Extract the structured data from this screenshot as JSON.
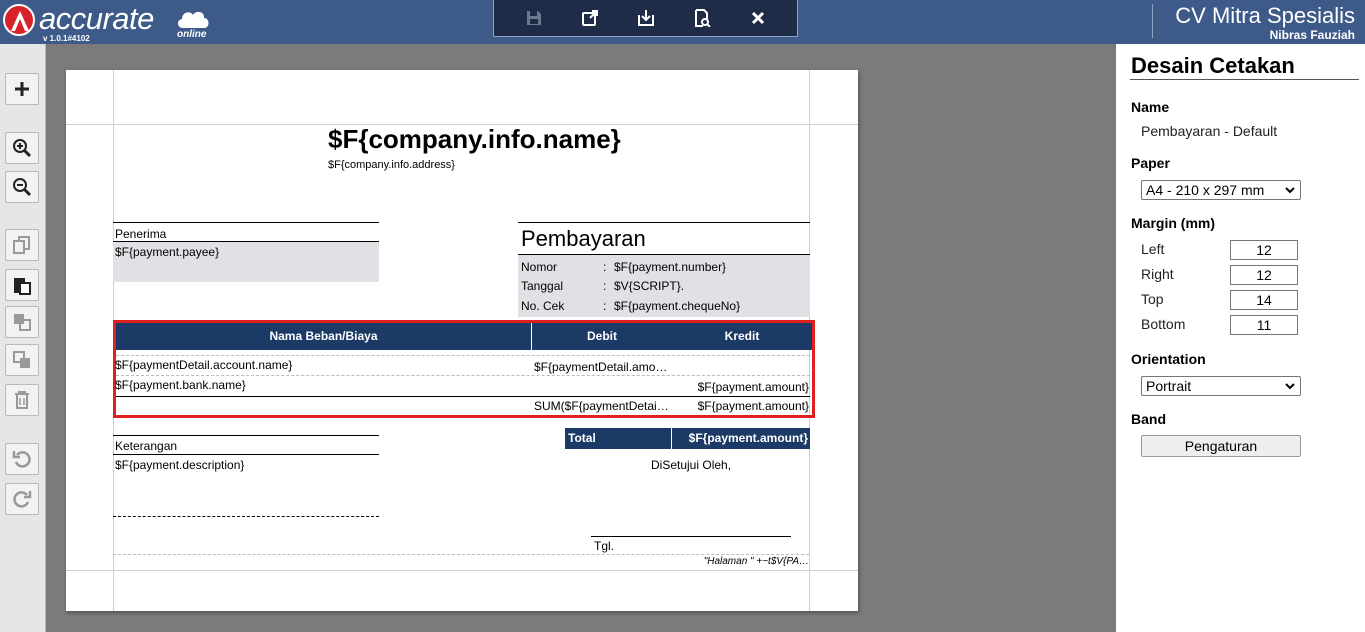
{
  "header": {
    "logo_word": "accurate",
    "logo_version": "v 1.0.1#4102",
    "logo_suffix": "online",
    "company_name": "CV Mitra Spesialis",
    "user_name": "Nibras Fauziah"
  },
  "toolbar": {
    "icons": [
      "save-icon",
      "export-icon",
      "import-icon",
      "preview-icon",
      "close-icon"
    ]
  },
  "leftbar": {
    "icons": [
      "plus-icon",
      "zoom-in-icon",
      "zoom-out-icon",
      "copy-icon",
      "paste-icon",
      "bring-front-icon",
      "send-back-icon",
      "trash-icon",
      "undo-icon",
      "redo-icon"
    ]
  },
  "page": {
    "company_name": "$F{company.info.name}",
    "company_address": "$F{company.info.address}",
    "payee_label": "Penerima",
    "payee_value": "$F{payment.payee}",
    "doc_title": "Pembayaran",
    "info": [
      {
        "label": "Nomor",
        "sep": ":",
        "value": "$F{payment.number}"
      },
      {
        "label": "Tanggal",
        "sep": ":",
        "value": "$V{SCRIPT}."
      },
      {
        "label": "No. Cek",
        "sep": ":",
        "value": "$F{payment.chequeNo}"
      }
    ],
    "table": {
      "headers": [
        "Nama Beban/Biaya",
        "Debit",
        "Kredit"
      ],
      "row1_name": "$F{paymentDetail.account.name}",
      "row1_debit": "$F{paymentDetail.amo…",
      "row2_name": "$F{payment.bank.name}",
      "row2_kredit": "$F{payment.amount}",
      "sum_debit": "SUM($F{paymentDetai…",
      "sum_kredit": "$F{payment.amount}"
    },
    "notes_label": "Keterangan",
    "notes_value": "$F{payment.description}",
    "total_label": "Total",
    "total_value": "$F{payment.amount}",
    "approved": "DiSetujui Oleh,",
    "date_label": "Tgl.",
    "footer": "\"Halaman \" +~t$V{PA…"
  },
  "panel": {
    "title": "Desain Cetakan",
    "name_label": "Name",
    "name_value": "Pembayaran - Default",
    "paper_label": "Paper",
    "paper_value": "A4 - 210 x 297 mm",
    "margin_label": "Margin (mm)",
    "margins": [
      {
        "label": "Left",
        "value": "12"
      },
      {
        "label": "Right",
        "value": "12"
      },
      {
        "label": "Top",
        "value": "14"
      },
      {
        "label": "Bottom",
        "value": "11"
      }
    ],
    "orientation_label": "Orientation",
    "orientation_value": "Portrait",
    "band_label": "Band",
    "band_button": "Pengaturan"
  },
  "colors": {
    "header_bg": "#3d5a88",
    "toolbar_bg": "#1e2c48",
    "table_header": "#1b3a66",
    "highlight": "#e0201f",
    "logo_red": "#d8232a"
  }
}
